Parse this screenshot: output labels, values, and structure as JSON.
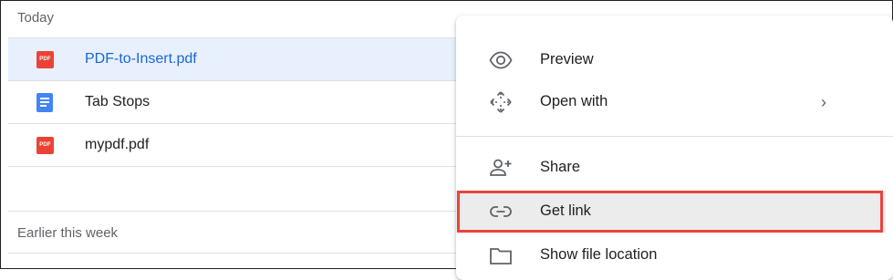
{
  "sections": {
    "today": "Today",
    "earlier": "Earlier this week"
  },
  "files": [
    {
      "name": "PDF-to-Insert.pdf",
      "type": "pdf",
      "selected": true
    },
    {
      "name": "Tab Stops",
      "type": "doc",
      "selected": false
    },
    {
      "name": "mypdf.pdf",
      "type": "pdf",
      "selected": false
    }
  ],
  "pdf_icon_text": "PDF",
  "menu": {
    "items": [
      {
        "label": "Preview",
        "icon": "eye-icon"
      },
      {
        "label": "Open with",
        "icon": "move-icon",
        "has_submenu": true
      },
      {
        "label": "Share",
        "icon": "add-person-icon"
      },
      {
        "label": "Get link",
        "icon": "link-icon",
        "highlighted": true
      },
      {
        "label": "Show file location",
        "icon": "folder-icon"
      }
    ],
    "submenu_glyph": "›"
  },
  "colors": {
    "selected_row_bg": "#e8f0fe",
    "selected_text": "#1967d2",
    "pdf_red": "#ea4335",
    "doc_blue": "#4285f4",
    "highlight_border": "#e8453c"
  }
}
